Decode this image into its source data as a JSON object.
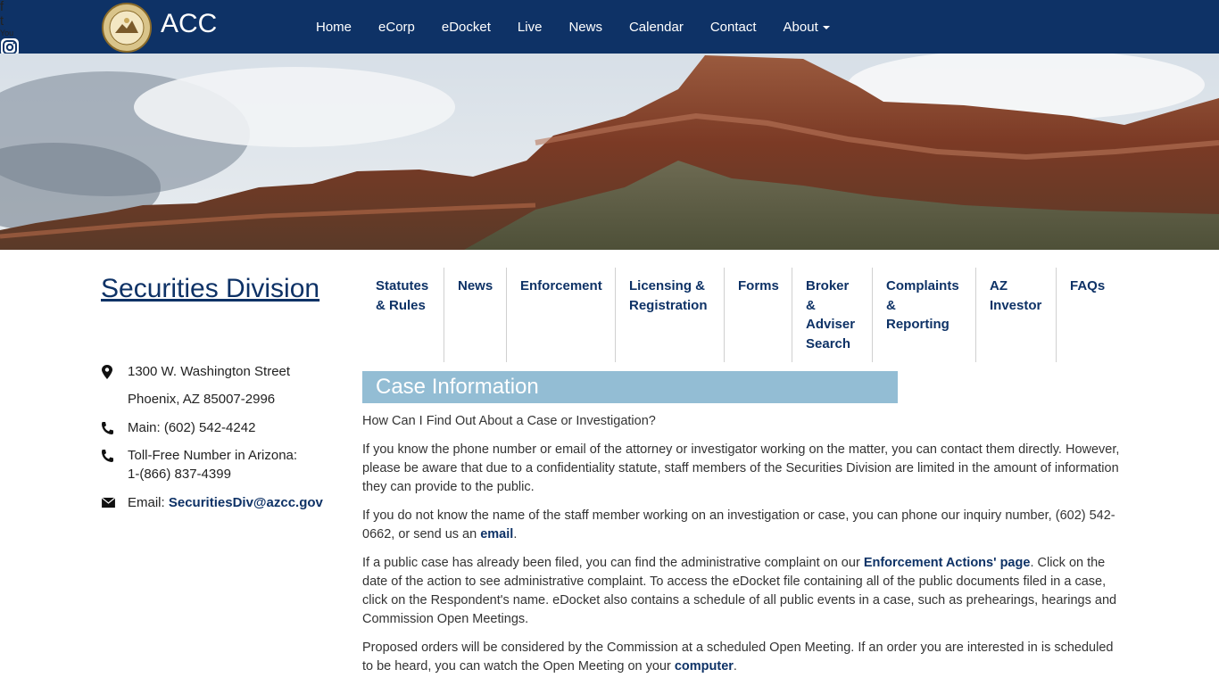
{
  "header": {
    "brand": "ACC",
    "nav": [
      "Home",
      "eCorp",
      "eDocket",
      "Live",
      "News",
      "Calendar",
      "Contact",
      "About"
    ],
    "social_icons": [
      "facebook-icon",
      "twitter-icon",
      "youtube-icon",
      "instagram-icon",
      "linkedin-icon"
    ]
  },
  "division": {
    "title": "Securities Division"
  },
  "subnav": {
    "items": [
      {
        "label": "Statutes & Rules"
      },
      {
        "label": "News"
      },
      {
        "label": "Enforcement"
      },
      {
        "label": "Licensing & Registration"
      },
      {
        "label": "Forms"
      },
      {
        "label": "Broker & Adviser Search"
      },
      {
        "label": "Complaints & Reporting"
      },
      {
        "label": "AZ Investor"
      },
      {
        "label": "FAQs"
      }
    ]
  },
  "contact": {
    "address_line1": "1300 W. Washington Street",
    "address_line2": "Phoenix, AZ 85007-2996",
    "main_phone": "Main: (602) 542-4242",
    "tollfree_line1": "Toll-Free Number in Arizona:",
    "tollfree_line2": "1-(866) 837-4399",
    "email_label": "Email:",
    "email": "SecuritiesDiv@azcc.gov"
  },
  "main": {
    "heading": "Case Information",
    "question": "How Can I Find Out About a Case or Investigation?",
    "p1": "If you know the phone number or email of the attorney or investigator working on the matter, you can contact them directly. However, please be aware that due to a confidentiality statute, staff members of the Securities Division are limited in the amount of information they can provide to the public.",
    "p2_pre": "If you do not know the name of the staff member working on an investigation or case, you can phone our inquiry number, (602) 542-0662, or send us an ",
    "p2_link": "email",
    "p2_post": ".",
    "p3_pre": "If a public case has already been filed, you can find the administrative complaint on our ",
    "p3_link": "Enforcement Actions' page",
    "p3_post": ".  Click on the date of the action to see administrative complaint. To access the eDocket file containing all of the public documents filed in a case, click on the Respondent's name. eDocket also contains a schedule of all public events in a case, such as prehearings, hearings and Commission Open Meetings.",
    "p4_pre": "Proposed orders will be considered by the Commission at a scheduled Open Meeting.  If an order you are interested in is scheduled to be heard, you can watch the Open Meeting on your ",
    "p4_link": "computer",
    "p4_post": "."
  },
  "colors": {
    "header_bg": "#0e3266",
    "heading_bar": "#93bdd4",
    "link": "#0e3266"
  }
}
